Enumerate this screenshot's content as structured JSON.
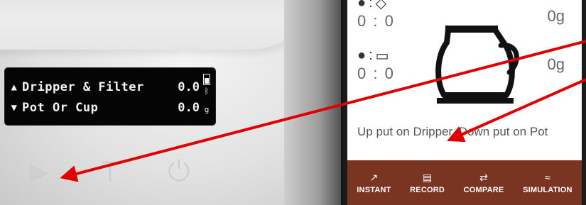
{
  "scale": {
    "oled": {
      "row1_label": "Dripper & Filter",
      "row1_value": "0.0",
      "row2_label": "Pot Or Cup",
      "row2_value": "0.0",
      "unit": "g"
    },
    "buttons": {
      "play_symbol": "▶",
      "tare_label": "T",
      "power_symbol": "⏻"
    }
  },
  "app": {
    "dripper": {
      "time": "0 : 0",
      "weight": "0g"
    },
    "pot": {
      "time": "0 : 0",
      "weight": "0g"
    },
    "hint": "Up put on Dripper, Down put on Pot",
    "nav": [
      {
        "label": "INSTANT",
        "icon": "trend-icon"
      },
      {
        "label": "RECORD",
        "icon": "document-icon"
      },
      {
        "label": "COMPARE",
        "icon": "compare-icon"
      },
      {
        "label": "SIMULATION",
        "icon": "simulation-icon"
      }
    ]
  },
  "colors": {
    "nav_background": "#7a3522",
    "arrow": "#e00000",
    "oled_background": "#050505"
  }
}
